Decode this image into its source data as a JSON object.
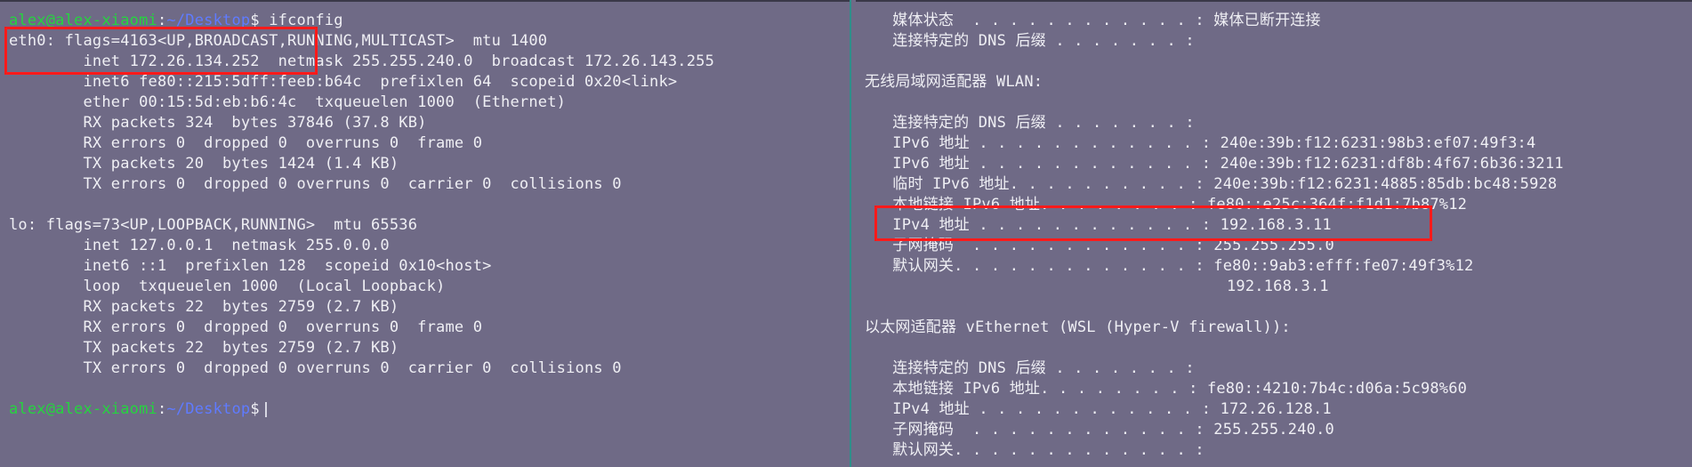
{
  "left_terminal": {
    "prompt": {
      "user": "alex@alex-xiaomi",
      "sep": ":",
      "path": "~/Desktop",
      "symbol": "$"
    },
    "command": "ifconfig",
    "lines": [
      "eth0: flags=4163<UP,BROADCAST,RUNNING,MULTICAST>  mtu 1400",
      "        inet 172.26.134.252  netmask 255.255.240.0  broadcast 172.26.143.255",
      "        inet6 fe80::215:5dff:feeb:b64c  prefixlen 64  scopeid 0x20<link>",
      "        ether 00:15:5d:eb:b6:4c  txqueuelen 1000  (Ethernet)",
      "        RX packets 324  bytes 37846 (37.8 KB)",
      "        RX errors 0  dropped 0  overruns 0  frame 0",
      "        TX packets 20  bytes 1424 (1.4 KB)",
      "        TX errors 0  dropped 0 overruns 0  carrier 0  collisions 0",
      "",
      "lo: flags=73<UP,LOOPBACK,RUNNING>  mtu 65536",
      "        inet 127.0.0.1  netmask 255.0.0.0",
      "        inet6 ::1  prefixlen 128  scopeid 0x10<host>",
      "        loop  txqueuelen 1000  (Local Loopback)",
      "        RX packets 22  bytes 2759 (2.7 KB)",
      "        RX errors 0  dropped 0  overruns 0  frame 0",
      "        TX packets 22  bytes 2759 (2.7 KB)",
      "        TX errors 0  dropped 0 overruns 0  carrier 0  collisions 0",
      ""
    ]
  },
  "right_terminal": {
    "lines": [
      "   媒体状态  . . . . . . . . . . . . : 媒体已断开连接",
      "   连接特定的 DNS 后缀 . . . . . . . :",
      "",
      "无线局域网适配器 WLAN:",
      "",
      "   连接特定的 DNS 后缀 . . . . . . . :",
      "   IPv6 地址 . . . . . . . . . . . . : 240e:39b:f12:6231:98b3:ef07:49f3:4",
      "   IPv6 地址 . . . . . . . . . . . . : 240e:39b:f12:6231:df8b:4f67:6b36:3211",
      "   临时 IPv6 地址. . . . . . . . . . : 240e:39b:f12:6231:4885:85db:bc48:5928",
      "   本地链接 IPv6 地址. . . . . . . . : fe80::e25c:364f:f1d1:7b87%12",
      "   IPv4 地址 . . . . . . . . . . . . : 192.168.3.11",
      "   子网掩码  . . . . . . . . . . . . : 255.255.255.0",
      "   默认网关. . . . . . . . . . . . . : fe80::9ab3:efff:fe07:49f3%12",
      "                                       192.168.3.1",
      "",
      "以太网适配器 vEthernet (WSL (Hyper-V firewall)):",
      "",
      "   连接特定的 DNS 后缀 . . . . . . . :",
      "   本地链接 IPv6 地址. . . . . . . . : fe80::4210:7b4c:d06a:5c98%60",
      "   IPv4 地址 . . . . . . . . . . . . : 172.26.128.1",
      "   子网掩码  . . . . . . . . . . . . : 255.255.240.0",
      "   默认网关. . . . . . . . . . . . . :"
    ]
  },
  "colors": {
    "background": "#6f6a86",
    "text": "#efeff4",
    "prompt_user": "#25d43f",
    "prompt_path": "#5f7bff",
    "highlight": "#ff1a1a",
    "divider": "#2f8f8a"
  }
}
